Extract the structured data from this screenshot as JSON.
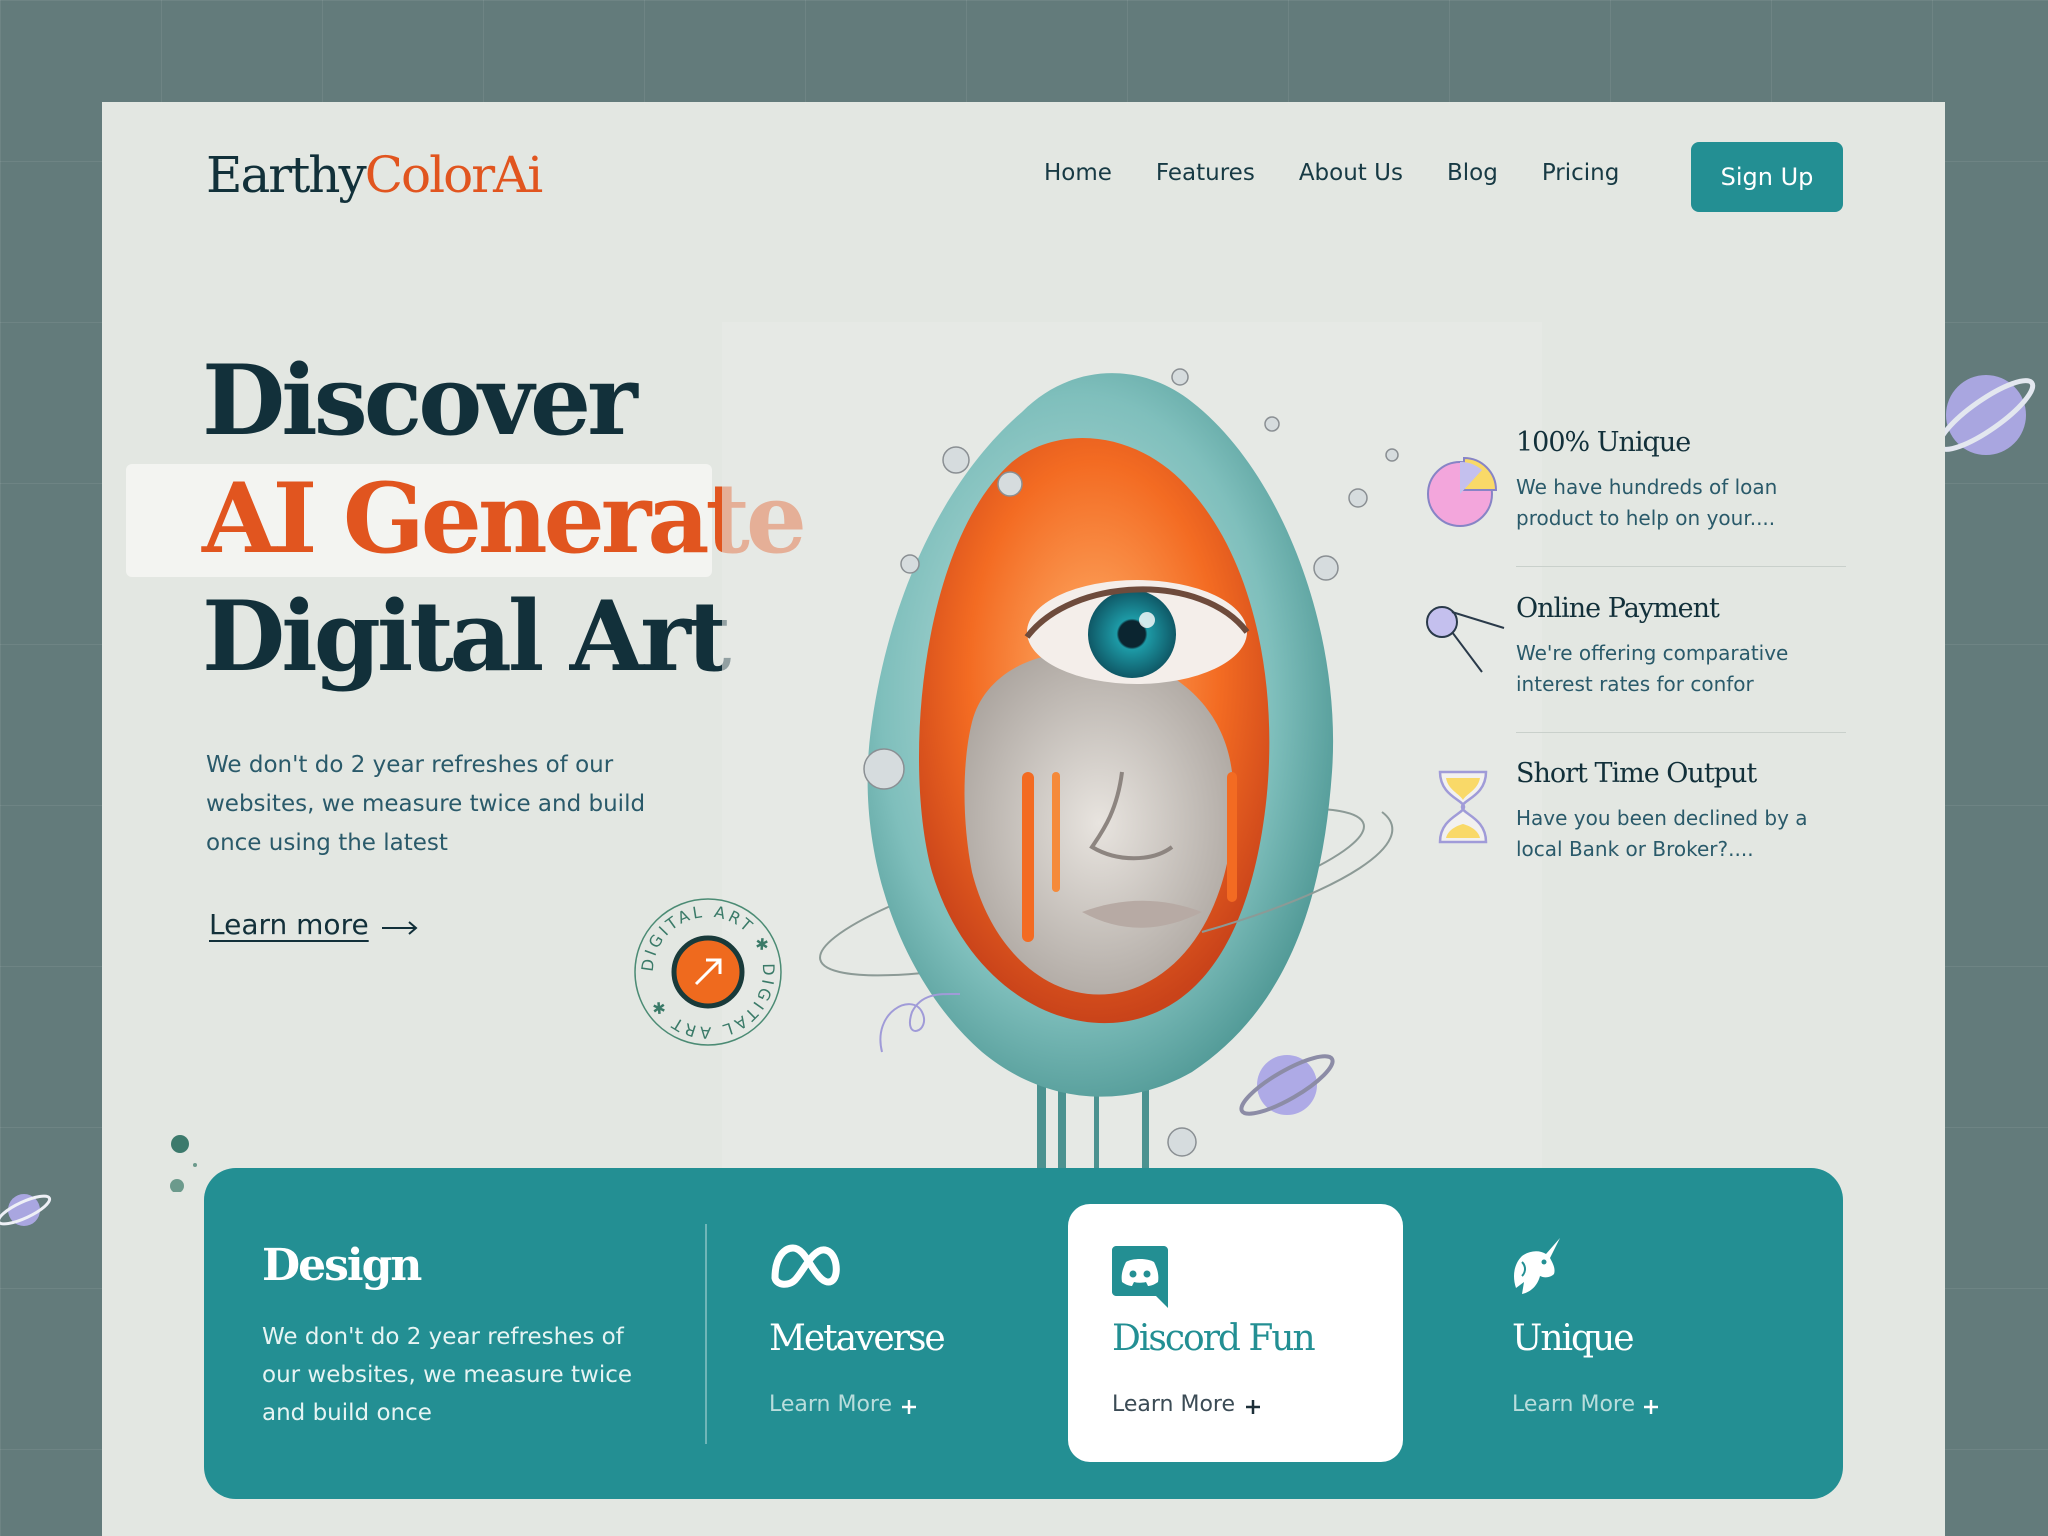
{
  "brand": {
    "name_main": "Earthy",
    "name_accent": "ColorAi"
  },
  "nav": {
    "items": [
      "Home",
      "Features",
      "About Us",
      "Blog",
      "Pricing"
    ],
    "signup_label": "Sign Up"
  },
  "hero": {
    "line1": "Discover",
    "line2": "AI Generate",
    "line3": "Digital Art",
    "description": "We don't do 2 year refreshes of our websites, we measure twice and build once using the latest",
    "learn_more": "Learn more",
    "badge_text": "DIGITAL ART ✱ DIGITAL ART ✱"
  },
  "features": [
    {
      "title": "100% Unique",
      "text": "We have hundreds of loan product to help on your....",
      "icon": "pie-chart-icon"
    },
    {
      "title": "Online Payment",
      "text": "We're offering comparative interest rates for confor",
      "icon": "satellite-icon"
    },
    {
      "title": "Short Time Output",
      "text": "Have you been declined by a local Bank or Broker?....",
      "icon": "hourglass-icon"
    }
  ],
  "band": {
    "design_title": "Design",
    "design_text": "We don't do 2 year refreshes of our websites, we measure twice and build once",
    "items": [
      {
        "name": "Metaverse",
        "more": "Learn More",
        "icon": "meta-icon"
      },
      {
        "name": "Discord Fun",
        "more": "Learn More",
        "icon": "discord-icon"
      },
      {
        "name": "Unique",
        "more": "Learn More",
        "icon": "unicorn-icon"
      }
    ]
  },
  "colors": {
    "accent": "#e1551f",
    "teal": "#238f93",
    "dark": "#12303a",
    "page": "#e3e7e2",
    "backdrop": "#637b7b"
  }
}
